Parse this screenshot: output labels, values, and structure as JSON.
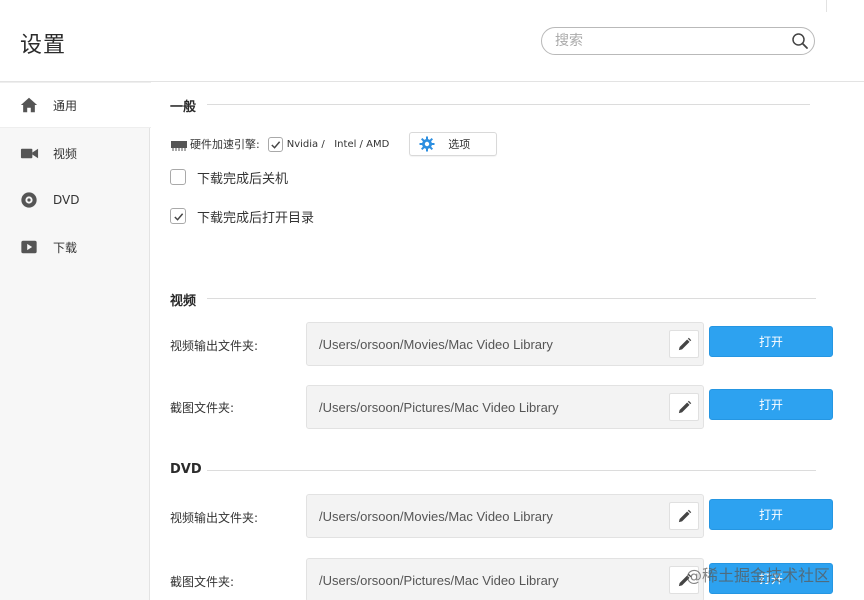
{
  "window": {
    "title": "设置"
  },
  "search": {
    "placeholder": "搜索"
  },
  "sidebar": {
    "items": [
      {
        "label": "通用",
        "icon": "home-icon",
        "active": true
      },
      {
        "label": "视频",
        "icon": "video-camera-icon",
        "active": false
      },
      {
        "label": "DVD",
        "icon": "disc-icon",
        "active": false
      },
      {
        "label": "下载",
        "icon": "play-icon",
        "active": false
      }
    ]
  },
  "general": {
    "title": "一般",
    "hardware_label": "硬件加速引擎:",
    "hardware_checked": true,
    "hardware_options": "Nvidia /   Intel / AMD",
    "options_button": "选项",
    "shutdown_label": "下载完成后关机",
    "shutdown_checked": false,
    "open_dir_label": "下载完成后打开目录",
    "open_dir_checked": true
  },
  "video": {
    "title": "视频",
    "output_label": "视频输出文件夹:",
    "output_path": "/Users/orsoon/Movies/Mac Video Library",
    "screenshot_label": "截图文件夹:",
    "screenshot_path": "/Users/orsoon/Pictures/Mac Video Library",
    "open_label": "打开"
  },
  "dvd": {
    "title": "DVD",
    "output_label": "视频输出文件夹:",
    "output_path": "/Users/orsoon/Movies/Mac Video Library",
    "screenshot_label": "截图文件夹:",
    "screenshot_path": "/Users/orsoon/Pictures/Mac Video Library",
    "open_label": "打开"
  },
  "watermark": "@稀土掘金技术社区",
  "colors": {
    "accent": "#2da2f0",
    "sidebar_bg": "#f7f7f7"
  }
}
